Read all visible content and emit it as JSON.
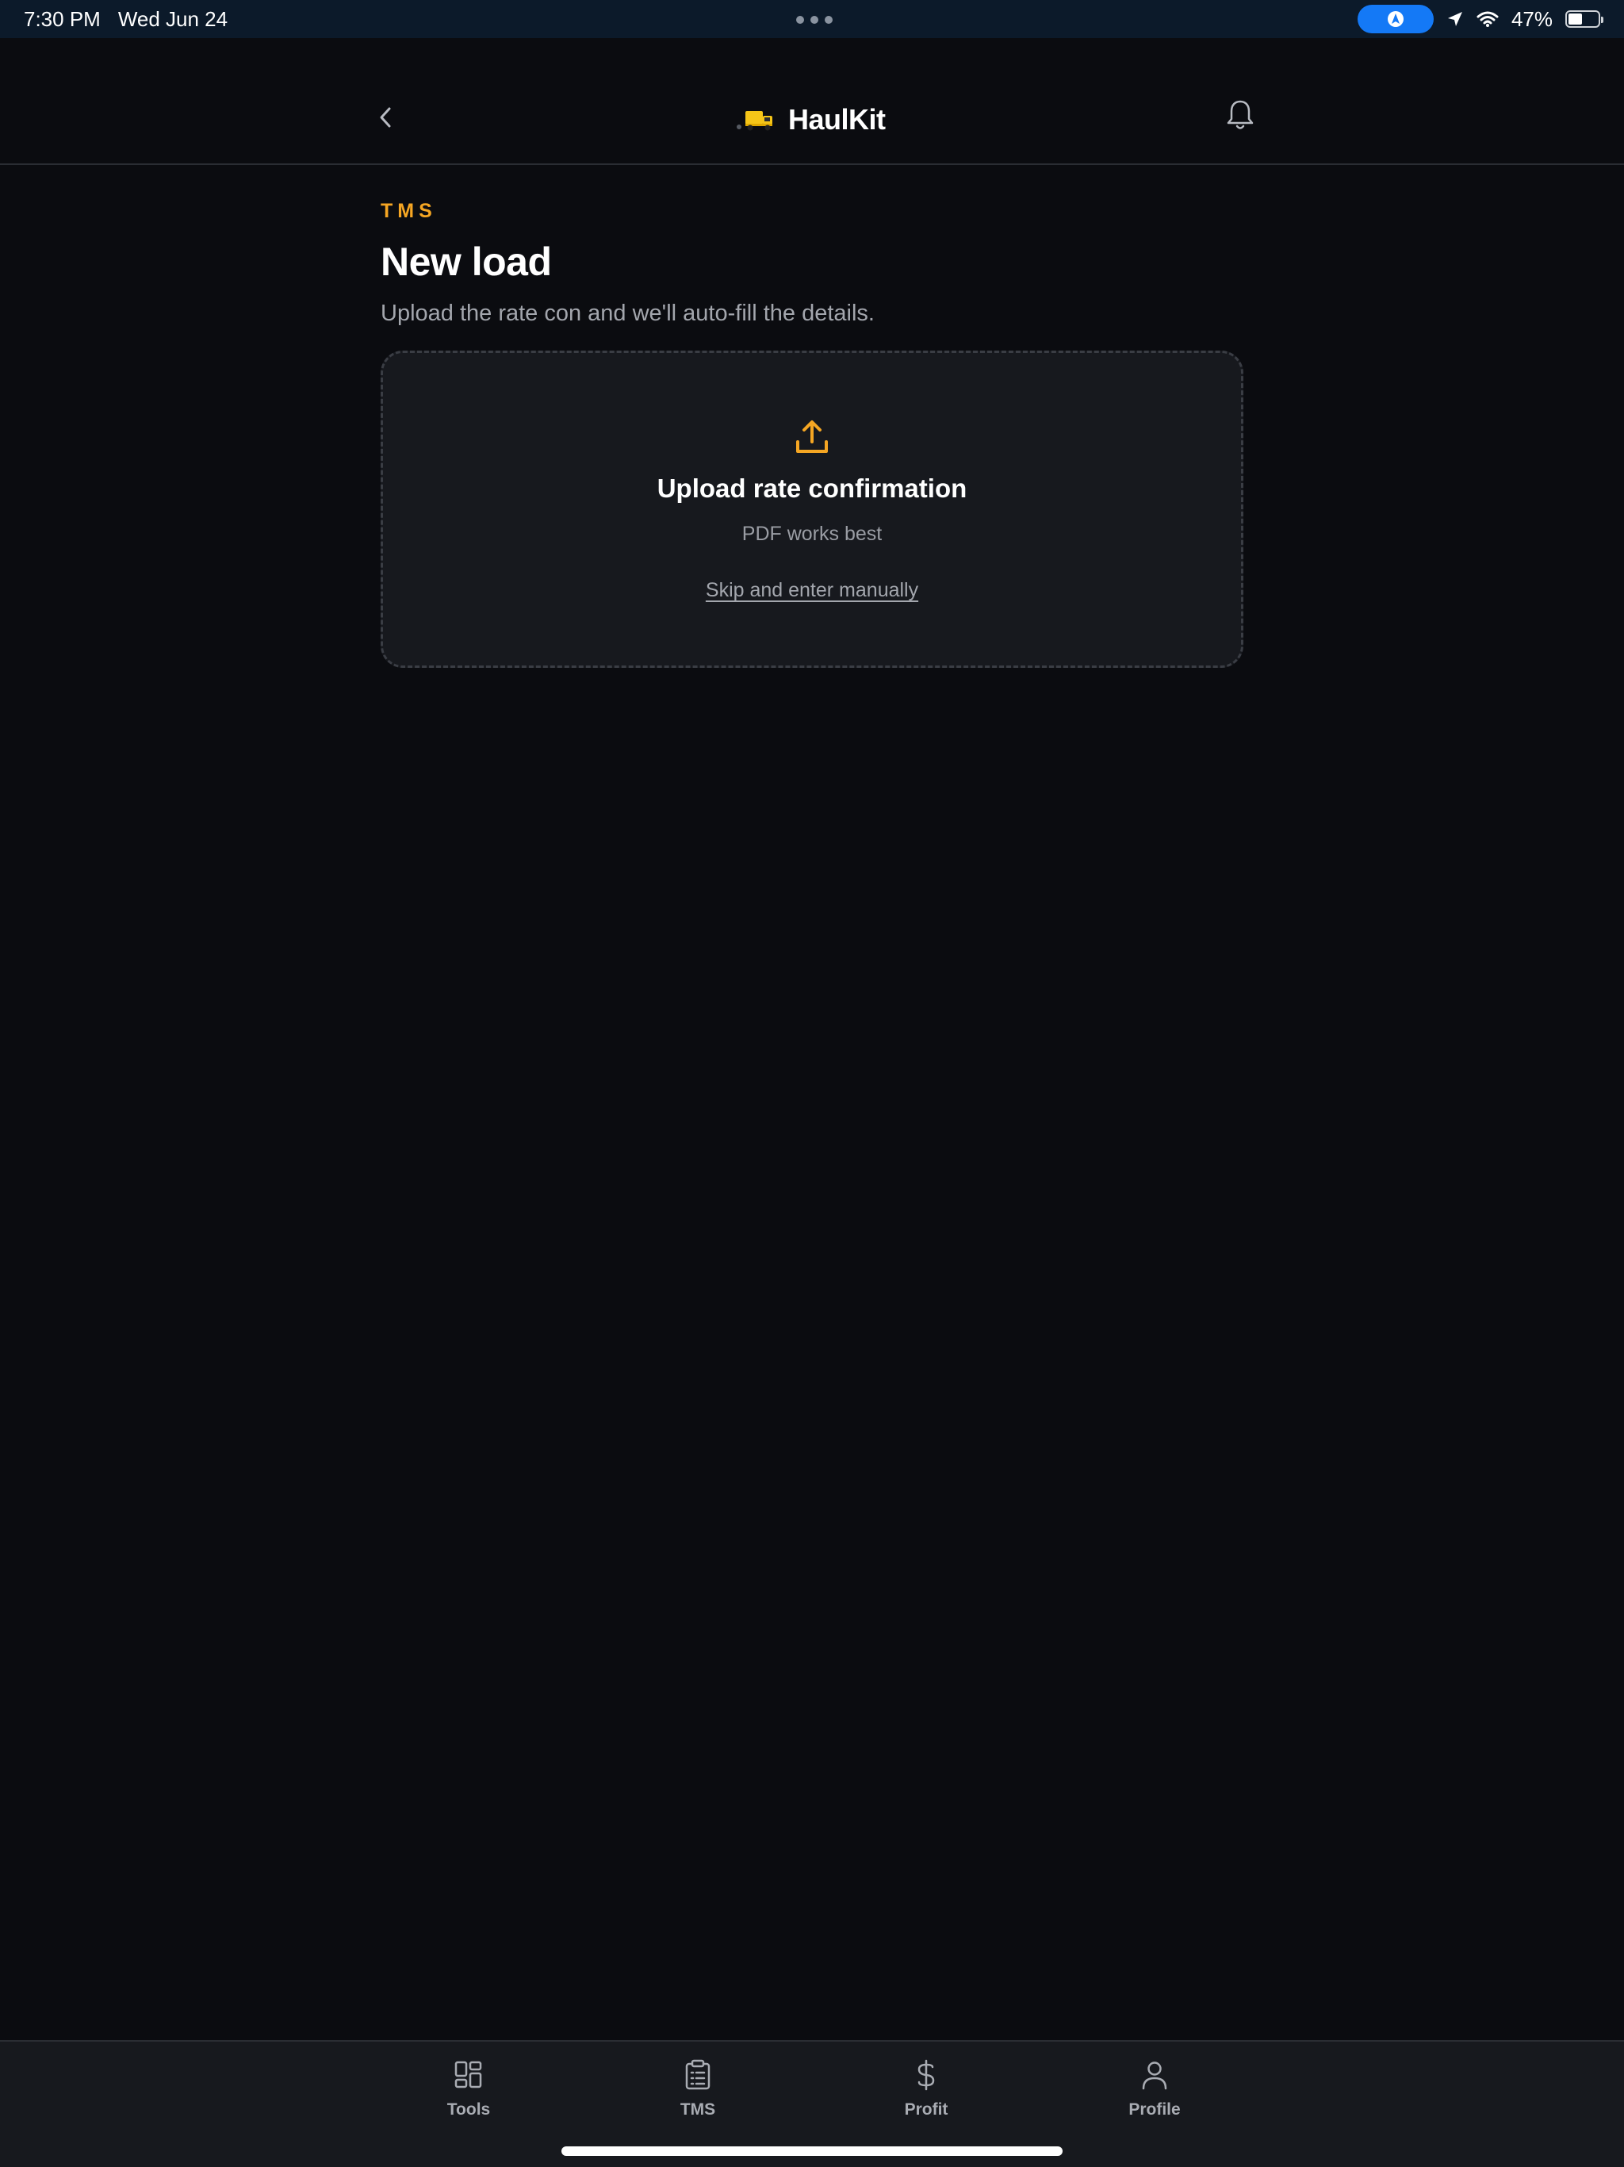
{
  "status_bar": {
    "time": "7:30 PM",
    "date": "Wed Jun 24",
    "battery": "47%",
    "battery_level": 0.47
  },
  "header": {
    "brand_name": "HaulKit",
    "logo_icon": "truck-icon"
  },
  "page": {
    "eyebrow": "TMS",
    "title": "New load",
    "subtitle": "Upload the rate con and we'll auto-fill the details."
  },
  "upload": {
    "title": "Upload rate confirmation",
    "hint": "PDF works best",
    "skip_label": "Skip and enter manually",
    "icon": "upload-icon"
  },
  "tabs": [
    {
      "label": "Tools",
      "icon": "grid-icon"
    },
    {
      "label": "TMS",
      "icon": "clipboard-icon"
    },
    {
      "label": "Profit",
      "icon": "dollar-icon"
    },
    {
      "label": "Profile",
      "icon": "user-icon"
    }
  ],
  "colors": {
    "accent": "#f5a623",
    "background": "#0b0c10",
    "card": "#17191e",
    "status_bar": "#0c1a2a",
    "nav_pill": "#1479f6"
  }
}
